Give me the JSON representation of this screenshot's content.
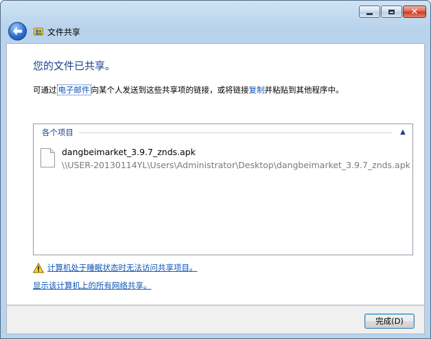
{
  "window": {
    "title": "文件共享",
    "caption_buttons": {
      "minimize": "–",
      "maximize": "□",
      "close": "✕"
    }
  },
  "main": {
    "heading": "您的文件已共享。",
    "desc_prefix": "可通过",
    "email_link": "电子邮件",
    "desc_middle": "向某个人发送到这些共享项的链接，或将链接",
    "copy_link": "复制",
    "desc_suffix": "并粘贴到其他程序中。"
  },
  "list": {
    "group_label": "各个项目",
    "items": [
      {
        "name": "dangbeimarket_3.9.7_znds.apk",
        "path": "\\\\USER-20130114YL\\Users\\Administrator\\Desktop\\dangbeimarket_3.9.7_znds.apk"
      }
    ]
  },
  "links": {
    "sleep_warning": "计算机处于睡眠状态时无法访问共享项目。",
    "show_shares": "显示该计算机上的所有网络共享。"
  },
  "footer": {
    "done_label": "完成(D)"
  },
  "colors": {
    "link": "#0f56b8",
    "heading": "#1e3f8c",
    "path_gray": "#7a7a7a"
  }
}
